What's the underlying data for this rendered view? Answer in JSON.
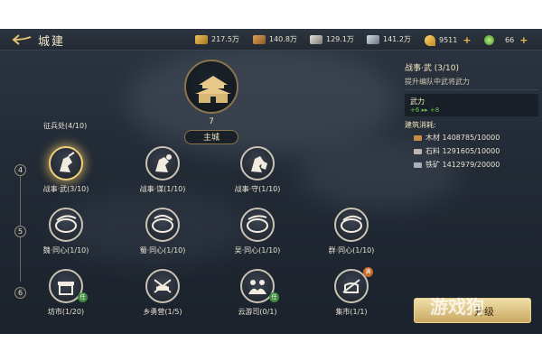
{
  "header": {
    "title": "城建",
    "resources": [
      {
        "icon": "military-supply-icon",
        "value": "217.5万",
        "color": "#d9a441"
      },
      {
        "icon": "wood-icon",
        "value": "140.8万",
        "color": "#c98a44"
      },
      {
        "icon": "stone-icon",
        "value": "129.1万",
        "color": "#b9b7ae"
      },
      {
        "icon": "iron-icon",
        "value": "141.2万",
        "color": "#a7b0bb"
      }
    ],
    "gold": {
      "icon": "gold-horn-icon",
      "value": "9511",
      "plus": "+"
    },
    "jade": {
      "icon": "jade-coin-icon",
      "value": "66",
      "plus": "+"
    }
  },
  "main_city": {
    "level": "7",
    "name": "主城"
  },
  "tech_tree": {
    "row_header": "征兵处(4/10)",
    "rows": [
      {
        "level": "4",
        "nodes": [
          {
            "icon": "warrior-attack-icon",
            "label": "战事·武(3/10)",
            "active": true
          },
          {
            "icon": "warrior-strategy-icon",
            "label": "战事·谋(1/10)"
          },
          {
            "icon": "warrior-defense-icon",
            "label": "战事·守(1/10)"
          }
        ]
      },
      {
        "level": "5",
        "nodes": [
          {
            "icon": "wei-emblem-icon",
            "label": "魏·同心(1/10)"
          },
          {
            "icon": "shu-emblem-icon",
            "label": "蜀·同心(1/10)"
          },
          {
            "icon": "wu-emblem-icon",
            "label": "吴·同心(1/10)"
          },
          {
            "icon": "qun-emblem-icon",
            "label": "群·同心(1/10)"
          }
        ]
      },
      {
        "level": "6",
        "nodes": [
          {
            "icon": "market-stall-icon",
            "label": "坊市(1/20)",
            "badge": "任",
            "badge_color": "green"
          },
          {
            "icon": "militia-camp-icon",
            "label": "乡勇营(1/5)"
          },
          {
            "icon": "wanderer-office-icon",
            "label": "云游司(0/1)",
            "badge": "任",
            "badge_color": "green"
          },
          {
            "icon": "bazaar-icon",
            "label": "集市(1/1)",
            "badge": "满",
            "badge_color": "orange"
          }
        ]
      }
    ]
  },
  "panel": {
    "title": "战事·武 (3/10)",
    "description": "提升编队中武将武力",
    "stat": {
      "name": "武力",
      "current": "+6",
      "next": "+8"
    },
    "cost_title": "建筑消耗:",
    "costs": [
      {
        "icon": "wood-icon",
        "text": "木材 1408785/10000"
      },
      {
        "icon": "stone-icon",
        "text": "石料 1291605/10000"
      },
      {
        "icon": "iron-icon",
        "text": "铁矿 1412979/20000"
      }
    ]
  },
  "action_button": {
    "label": "升级"
  },
  "watermark": "游戏狗"
}
